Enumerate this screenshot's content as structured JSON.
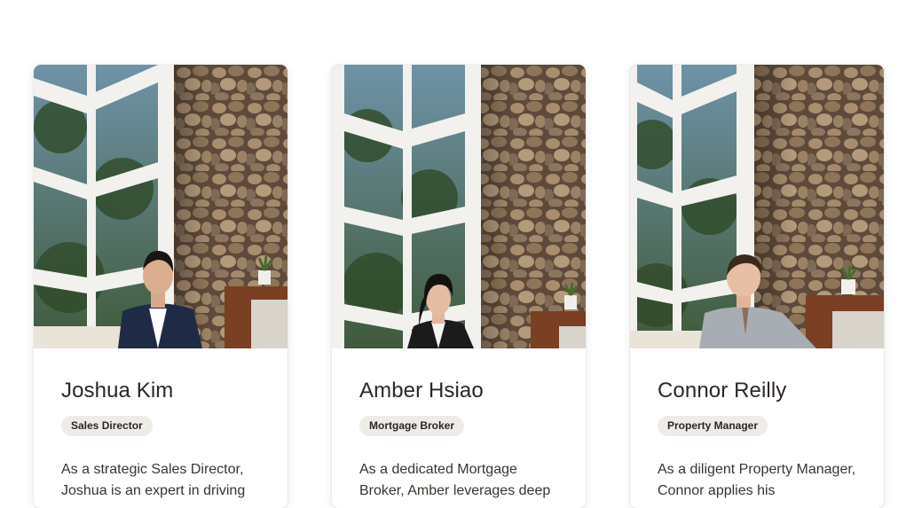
{
  "team": [
    {
      "name": "Joshua Kim",
      "role": "Sales Director",
      "bio": "As a strategic Sales Director, Joshua is an expert in driving",
      "photo_alt": "Joshua Kim portrait"
    },
    {
      "name": "Amber Hsiao",
      "role": "Mortgage Broker",
      "bio": "As a dedicated Mortgage Broker, Amber leverages deep",
      "photo_alt": "Amber Hsiao portrait"
    },
    {
      "name": "Connor Reilly",
      "role": "Property Manager",
      "bio": "As a diligent Property Manager, Connor applies his",
      "photo_alt": "Connor Reilly portrait"
    }
  ],
  "colors": {
    "badge_bg": "#efebe7",
    "stone": "#8a7560",
    "window_frame": "#f4f3f0",
    "wood": "#7b3f24"
  }
}
